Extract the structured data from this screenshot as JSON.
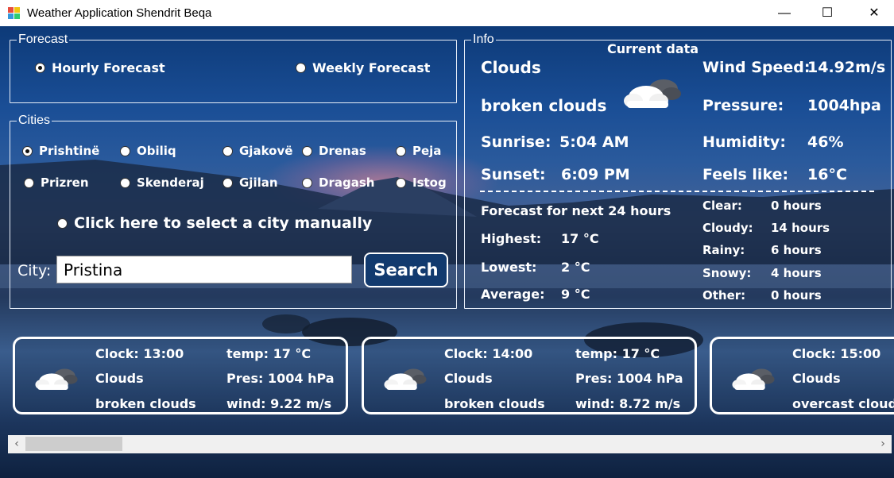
{
  "window": {
    "title": "Weather Application Shendrit Beqa",
    "minimize": "—",
    "maximize": "☐",
    "close": "✕"
  },
  "forecast_group": {
    "legend": "Forecast",
    "hourly": "Hourly Forecast",
    "weekly": "Weekly Forecast",
    "selected": "hourly"
  },
  "cities_group": {
    "legend": "Cities",
    "cities": [
      "Prishtinë",
      "Obiliq",
      "Gjakovë",
      "Drenas",
      "Peja",
      "Prizren",
      "Skenderaj",
      "Gjilan",
      "Dragash",
      "Istog"
    ],
    "selected": "Prishtinë",
    "manual": "Click here to select a city manually"
  },
  "city_search": {
    "label": "City:",
    "value": "Pristina",
    "button": "Search"
  },
  "info_group": {
    "legend": "Info",
    "heading": "Current data",
    "condition": "Clouds",
    "description": "broken clouds",
    "sunrise_label": "Sunrise:",
    "sunrise": "5:04 AM",
    "sunset_label": "Sunset:",
    "sunset": "6:09 PM",
    "wind_label": "Wind Speed:",
    "wind": "14.92m/s",
    "pressure_label": "Pressure:",
    "pressure": "1004hpa",
    "humidity_label": "Humidity:",
    "humidity": "46%",
    "feels_label": "Feels like:",
    "feels": "16°C",
    "forecast24_heading": "Forecast for next 24 hours",
    "highest_label": "Highest:",
    "highest": "17 °C",
    "lowest_label": "Lowest:",
    "lowest": "2 °C",
    "average_label": "Average:",
    "average": "9 °C",
    "clear_label": "Clear:",
    "clear": "0  hours",
    "cloudy_label": "Cloudy:",
    "cloudy": "14  hours",
    "rainy_label": "Rainy:",
    "rainy": "6  hours",
    "snowy_label": "Snowy:",
    "snowy": "4  hours",
    "other_label": "Other:",
    "other": "0  hours",
    "icon": "cloudy-icon"
  },
  "hourly_cards": [
    {
      "clock": "Clock: 13:00",
      "condition": "Clouds",
      "description": "broken clouds",
      "temp": "temp: 17 °C",
      "pressure": "Pres: 1004 hPa",
      "wind": "wind: 9.22 m/s",
      "icon": "cloudy-icon"
    },
    {
      "clock": "Clock: 14:00",
      "condition": "Clouds",
      "description": "broken clouds",
      "temp": "temp: 17 °C",
      "pressure": "Pres: 1004 hPa",
      "wind": "wind: 8.72 m/s",
      "icon": "cloudy-icon"
    },
    {
      "clock": "Clock: 15:00",
      "condition": "Clouds",
      "description": "overcast cloud",
      "icon": "cloudy-icon"
    }
  ],
  "scrollbar": {
    "left_arrow": "‹",
    "right_arrow": "›"
  }
}
